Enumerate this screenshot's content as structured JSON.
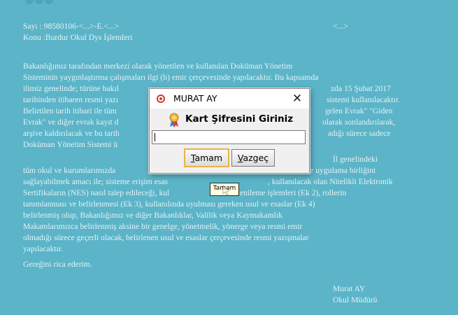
{
  "document": {
    "sayi_left": "Sayı  : 98580106-<...>-E.<...>",
    "sayi_right": "<...>",
    "konu": "Konu :Burdur Okul Dys İşlemleri",
    "lines": [
      "Bakanlığımız tarafından merkezi olarak yönetilen ve kullanılan Doküman Yönetim",
      "Sisteminin yaygınlaştırma çalışmaları ilgi (b) emir çerçevesinde yapılacaktır. Bu kapsamda",
      "ilimiz genelinde; türüne bakıl",
      "tarihinden itibaren resmi yazı",
      "Belirtilen tarih itibari ile tüm",
      "Evrak\" ve diğer evrak kayıt d",
      "arşive kaldırılacak ve bu tarih",
      "Doküman Yönetim Sistemi ü"
    ],
    "right_fragments": [
      "zda 15 Şubat 2017",
      "sistemi kullanılacaktır.",
      "gelen Evrak\" \"Giden",
      " olarak sonlandırılarak,",
      "adığı sürece sadece"
    ],
    "il_genelindeki": "İl genelindeki",
    "lines2": [
      "tüm okul ve kurumlarımızda",
      "sağlayabilmek amacı ile; sisteme erişim esas",
      "Sertifikaların (NES) nasıl talep edileceği, kul",
      "tanımlanması ve belirlenmesi (Ek 3), kullanılında uyulması gereken usul ve esaslar (Ek 4)",
      "belirlenmiş olup, Bakanlığımız ve diğer Bakanlıklar, Valilik veya Kaymakamlık",
      "Makamlarımızca belirlenmiş aksine bir genelge, yönetmelik, yönerge veya resmi emir",
      "olmadığı sürece geçerli olacak, belirlenen usul ve esaslar çerçevesinde resmi yazışmalar",
      "yapılacaktır.",
      "Gereğini rica ederim."
    ],
    "right_fragments2": [
      "te uygulama birliğini",
      ", kullanılacak olan Nitelikli Elektronik",
      "enileme işlemleri (Ek 2), rollerin"
    ],
    "signature_name": "Murat AY",
    "signature_title": "Okul Müdürü"
  },
  "dialog": {
    "title": "MURAT AY",
    "close_label": "✕",
    "heading": "Kart Şifresini Giriniz",
    "password_value": "",
    "ok_label_underlined": "T",
    "ok_label_rest": "amam",
    "cancel_label_underlined": "V",
    "cancel_label_rest": "azgeç"
  },
  "tooltip": {
    "text": "Tamam"
  },
  "colors": {
    "background": "#5bb4c8",
    "document_text": "#e4f3f7",
    "dialog_bg": "#f0f0f0",
    "default_button_focus": "#e8b449",
    "tooltip_bg": "#ffffe1"
  }
}
